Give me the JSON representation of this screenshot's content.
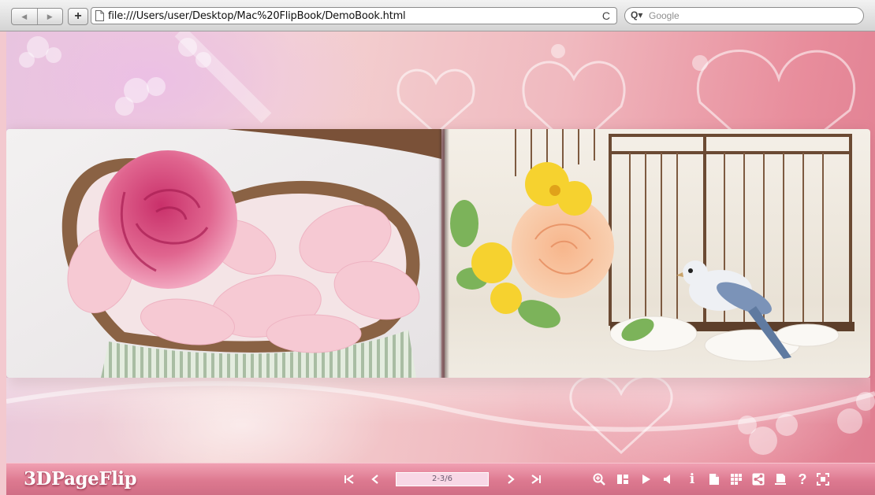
{
  "browser": {
    "back_icon": "back-arrow-icon",
    "forward_icon": "forward-arrow-icon",
    "add_label": "+",
    "url": "file:///Users/user/Desktop/Mac%20FlipBook/DemoBook.html",
    "reload_glyph": "C",
    "search_placeholder": "Google"
  },
  "book": {
    "left_page_image": "heart-box-with-pink-rose",
    "right_page_image": "flowers-and-bird-by-cage",
    "page_indicator": "2-3/6"
  },
  "toolbar": {
    "logo": "3DPageFlip",
    "buttons": [
      "first-page-icon",
      "previous-page-icon",
      "next-page-icon",
      "last-page-icon",
      "zoom-in-icon",
      "thumbnails-icon",
      "autoplay-icon",
      "sound-icon",
      "info-icon",
      "print-icon",
      "grid-icon",
      "share-icon",
      "download-icon",
      "help-icon",
      "fullscreen-icon"
    ],
    "help_glyph": "?",
    "info_glyph": "i"
  },
  "colors": {
    "toolbar": "#dd7990",
    "page_indicator_bg": "#f8d8e6",
    "background_accent": "#e88d9c"
  }
}
